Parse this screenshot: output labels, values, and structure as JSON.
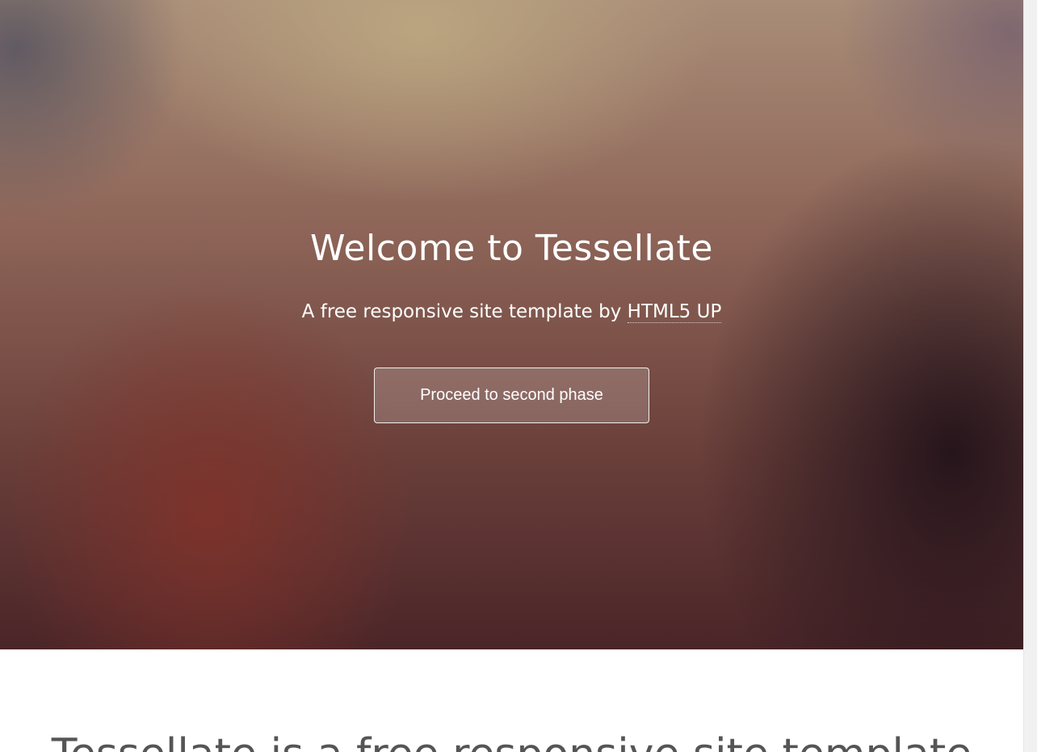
{
  "hero": {
    "title": "Welcome to Tessellate",
    "subtitle_prefix": "A free responsive site template by ",
    "subtitle_link": "HTML5 UP",
    "cta_label": "Proceed to second phase"
  },
  "intro": {
    "heading": "Tessellate is a free responsive site template"
  },
  "colors": {
    "hero_text": "#ffffff",
    "intro_text": "#555555",
    "page_background": "#ffffff"
  }
}
